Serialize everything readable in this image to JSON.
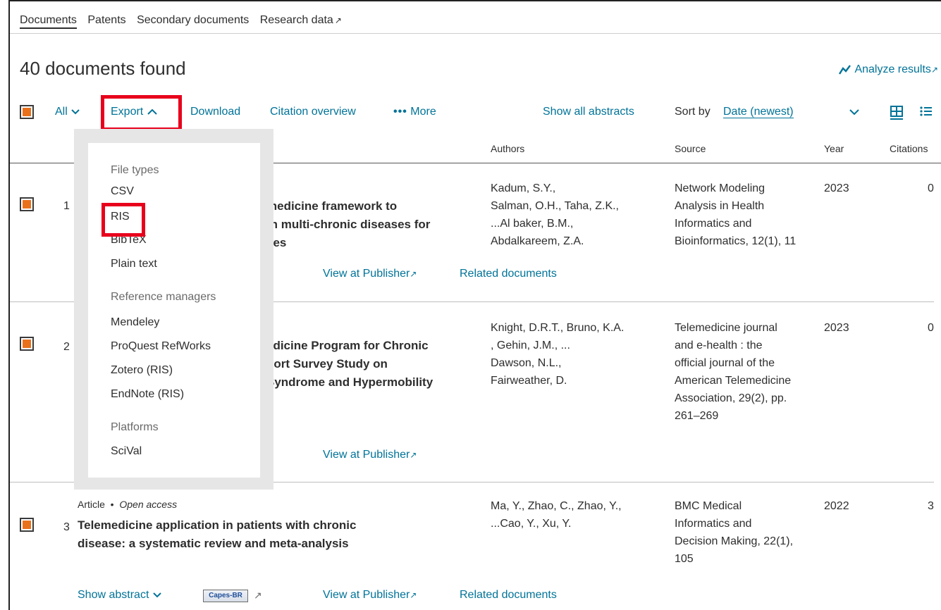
{
  "tabs": {
    "documents": "Documents",
    "patents": "Patents",
    "secondary": "Secondary documents",
    "research": "Research data"
  },
  "results": {
    "count_label": "40 documents found",
    "analyze_label": "Analyze results"
  },
  "toolbar": {
    "all_label": "All",
    "export_label": "Export",
    "download_label": "Download",
    "citation_label": "Citation overview",
    "more_label": "More",
    "show_abstracts_label": "Show all abstracts",
    "sort_by_label": "Sort by",
    "sort_value": "Date (newest)"
  },
  "table": {
    "headers": {
      "authors": "Authors",
      "source": "Source",
      "year": "Year",
      "citations": "Citations"
    }
  },
  "dropdown": {
    "section_file_types": "File types",
    "csv": "CSV",
    "ris": "RIS",
    "bibtex": "BibTeX",
    "plain_text": "Plain text",
    "section_ref_managers": "Reference managers",
    "mendeley": "Mendeley",
    "proquest": "ProQuest RefWorks",
    "zotero": "Zotero (RIS)",
    "endnote": "EndNote (RIS)",
    "section_platforms": "Platforms",
    "scival": "SciVal"
  },
  "rows": [
    {
      "num": "1",
      "title_l1": "medicine framework to",
      "title_l2": "th multi-chronic diseases for",
      "title_l3": "ces",
      "authors": [
        "Kadum, S.Y.,",
        "Salman, O.H., Taha, Z.K.,",
        "...Al baker, B.M.,",
        "Abdalkareem, Z.A."
      ],
      "source": [
        "Network Modeling",
        "Analysis in Health",
        "Informatics and",
        "Bioinformatics, 12(1), 11"
      ],
      "year": "2023",
      "citations": "0",
      "view_publisher": "View at Publisher",
      "related": "Related documents"
    },
    {
      "num": "2",
      "title_l1": "edicine Program for Chronic",
      "title_l2": "hort Survey Study on",
      "title_l3": "Syndrome and Hypermobility",
      "authors": [
        "Knight, D.R.T., Bruno, K.A.",
        ", Gehin, J.M., ...",
        "Dawson, N.L.,",
        "Fairweather, D."
      ],
      "source": [
        "Telemedicine journal",
        "and e-health : the",
        "official journal of the",
        "American Telemedicine",
        "Association, 29(2), pp.",
        "261–269"
      ],
      "year": "2023",
      "citations": "0",
      "view_publisher": "View at Publisher"
    },
    {
      "num": "3",
      "doc_type": "Article",
      "access": "Open access",
      "title_l1": "Telemedicine application in patients with chronic",
      "title_l2": "disease: a systematic review and meta-analysis",
      "authors": [
        "Ma, Y., Zhao, C., Zhao, Y.,",
        "...Cao, Y., Xu, Y."
      ],
      "source": [
        "BMC Medical",
        "Informatics and",
        "Decision Making, 22(1),",
        "105"
      ],
      "year": "2022",
      "citations": "3",
      "show_abstract": "Show abstract",
      "capes": "Capes-BR",
      "view_publisher": "View at Publisher",
      "related": "Related documents"
    }
  ],
  "colors": {
    "accent": "#007398",
    "checkbox": "#e9711c",
    "highlight": "#e8001c"
  }
}
